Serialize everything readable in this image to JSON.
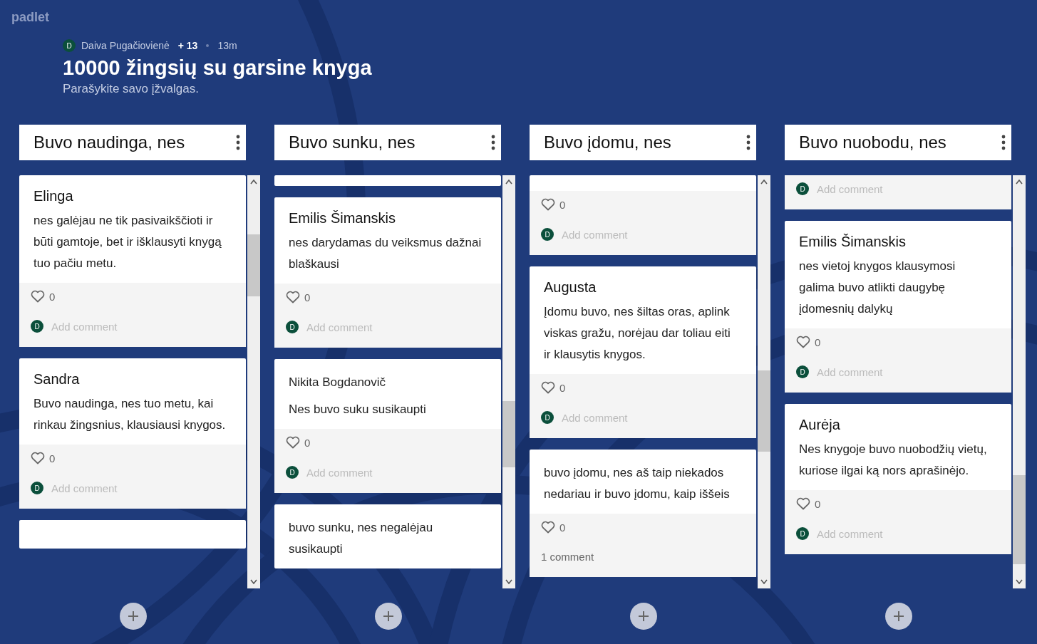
{
  "brand": "padlet",
  "author": {
    "initial": "D",
    "name": "Daiva Pugačiovienė",
    "contributors": "+ 13",
    "time": "13m"
  },
  "title": "10000 žingsių su garsine knyga",
  "subtitle": "Parašykite savo įžvalgas.",
  "columns": [
    {
      "title": "Buvo naudinga, nes",
      "posts": [
        {
          "kind": "post",
          "title": "Elinga",
          "paragraphs": [
            "nes galėjau ne tik pasivaikščioti ir būti gamtoje, bet ir išklausyti knygą tuo pačiu metu."
          ],
          "likes": "0",
          "avatar": "D",
          "comment": "Add comment"
        },
        {
          "kind": "post",
          "title": "Sandra",
          "paragraphs": [
            "Buvo naudinga, nes tuo metu, kai rinkau žingsnius, klausiausi knygos."
          ],
          "likes": "0",
          "avatar": "D",
          "comment": "Add comment"
        },
        {
          "kind": "stub"
        }
      ]
    },
    {
      "title": "Buvo sunku, nes",
      "posts": [
        {
          "kind": "stub"
        },
        {
          "kind": "post",
          "title": "Emilis Šimanskis",
          "paragraphs": [
            "nes darydamas du veiksmus dažnai blaškausi"
          ],
          "likes": "0",
          "avatar": "D",
          "comment": "Add comment"
        },
        {
          "kind": "post",
          "paragraphs": [
            "Nikita Bogdanovič",
            "Nes buvo suku susikaupti"
          ],
          "likes": "0",
          "avatar": "D",
          "comment": "Add comment"
        },
        {
          "kind": "post",
          "paragraphs": [
            "buvo sunku, nes negalėjau susikaupti"
          ]
        }
      ]
    },
    {
      "title": "Buvo įdomu, nes",
      "posts": [
        {
          "kind": "tail",
          "likes": "0",
          "avatar": "D",
          "comment": "Add comment"
        },
        {
          "kind": "post",
          "title": "Augusta",
          "paragraphs": [
            "Įdomu buvo, nes šiltas oras, aplink viskas gražu, norėjau dar toliau eiti ir klausytis knygos."
          ],
          "likes": "0",
          "avatar": "D",
          "comment": "Add comment"
        },
        {
          "kind": "post",
          "paragraphs": [
            "buvo įdomu, nes aš taip niekados nedariau ir buvo įdomu, kaip iššeis"
          ],
          "likes": "0",
          "comments": "1 comment"
        }
      ]
    },
    {
      "title": "Buvo nuobodu, nes",
      "posts": [
        {
          "kind": "tail",
          "avatar": "D",
          "comment": "Add comment"
        },
        {
          "kind": "post",
          "title": "Emilis Šimanskis",
          "paragraphs": [
            "nes vietoj knygos klausymosi galima buvo atlikti daugybę įdomesnių dalykų"
          ],
          "likes": "0",
          "avatar": "D",
          "comment": "Add comment"
        },
        {
          "kind": "post",
          "title": "Aurėja",
          "paragraphs": [
            "Nes knygoje buvo nuobodžių vietų, kuriose ilgai ką nors aprašinėjo."
          ],
          "likes": "0",
          "avatar": "D",
          "comment": "Add comment"
        }
      ]
    }
  ]
}
